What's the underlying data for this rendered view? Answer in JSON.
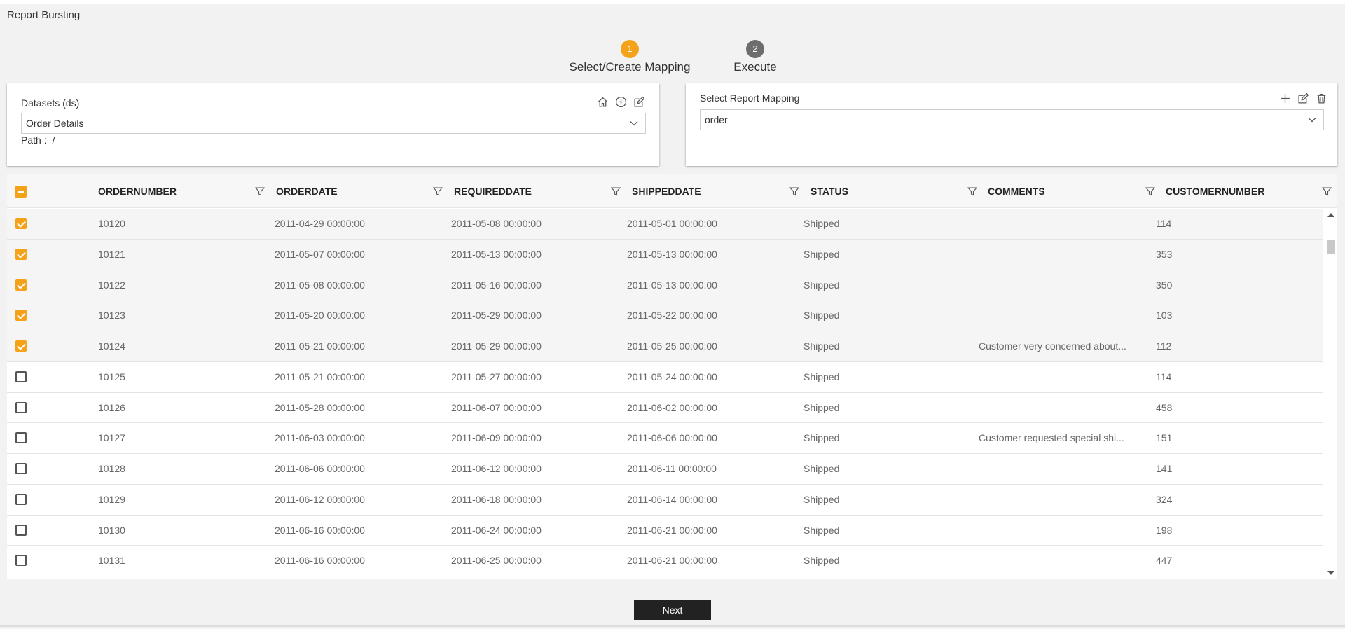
{
  "app": {
    "title": "Report Bursting"
  },
  "steps": [
    {
      "number": "1",
      "label": "Select/Create Mapping"
    },
    {
      "number": "2",
      "label": "Execute"
    }
  ],
  "dataset_panel": {
    "label": "Datasets (ds)",
    "selected": "Order Details",
    "path_label": "Path :",
    "path_value": "/"
  },
  "mapping_panel": {
    "label": "Select Report Mapping",
    "selected": "order"
  },
  "table": {
    "columns": [
      "ORDERNUMBER",
      "ORDERDATE",
      "REQUIREDDATE",
      "SHIPPEDDATE",
      "STATUS",
      "COMMENTS",
      "CUSTOMERNUMBER"
    ],
    "rows": [
      {
        "checked": true,
        "ordernumber": "10120",
        "orderdate": "2011-04-29 00:00:00",
        "requireddate": "2011-05-08 00:00:00",
        "shippeddate": "2011-05-01 00:00:00",
        "status": "Shipped",
        "comments": "",
        "customernumber": "114"
      },
      {
        "checked": true,
        "ordernumber": "10121",
        "orderdate": "2011-05-07 00:00:00",
        "requireddate": "2011-05-13 00:00:00",
        "shippeddate": "2011-05-13 00:00:00",
        "status": "Shipped",
        "comments": "",
        "customernumber": "353"
      },
      {
        "checked": true,
        "ordernumber": "10122",
        "orderdate": "2011-05-08 00:00:00",
        "requireddate": "2011-05-16 00:00:00",
        "shippeddate": "2011-05-13 00:00:00",
        "status": "Shipped",
        "comments": "",
        "customernumber": "350"
      },
      {
        "checked": true,
        "ordernumber": "10123",
        "orderdate": "2011-05-20 00:00:00",
        "requireddate": "2011-05-29 00:00:00",
        "shippeddate": "2011-05-22 00:00:00",
        "status": "Shipped",
        "comments": "",
        "customernumber": "103"
      },
      {
        "checked": true,
        "ordernumber": "10124",
        "orderdate": "2011-05-21 00:00:00",
        "requireddate": "2011-05-29 00:00:00",
        "shippeddate": "2011-05-25 00:00:00",
        "status": "Shipped",
        "comments": "Customer very concerned about...",
        "customernumber": "112"
      },
      {
        "checked": false,
        "ordernumber": "10125",
        "orderdate": "2011-05-21 00:00:00",
        "requireddate": "2011-05-27 00:00:00",
        "shippeddate": "2011-05-24 00:00:00",
        "status": "Shipped",
        "comments": "",
        "customernumber": "114"
      },
      {
        "checked": false,
        "ordernumber": "10126",
        "orderdate": "2011-05-28 00:00:00",
        "requireddate": "2011-06-07 00:00:00",
        "shippeddate": "2011-06-02 00:00:00",
        "status": "Shipped",
        "comments": "",
        "customernumber": "458"
      },
      {
        "checked": false,
        "ordernumber": "10127",
        "orderdate": "2011-06-03 00:00:00",
        "requireddate": "2011-06-09 00:00:00",
        "shippeddate": "2011-06-06 00:00:00",
        "status": "Shipped",
        "comments": "Customer requested special shi...",
        "customernumber": "151"
      },
      {
        "checked": false,
        "ordernumber": "10128",
        "orderdate": "2011-06-06 00:00:00",
        "requireddate": "2011-06-12 00:00:00",
        "shippeddate": "2011-06-11 00:00:00",
        "status": "Shipped",
        "comments": "",
        "customernumber": "141"
      },
      {
        "checked": false,
        "ordernumber": "10129",
        "orderdate": "2011-06-12 00:00:00",
        "requireddate": "2011-06-18 00:00:00",
        "shippeddate": "2011-06-14 00:00:00",
        "status": "Shipped",
        "comments": "",
        "customernumber": "324"
      },
      {
        "checked": false,
        "ordernumber": "10130",
        "orderdate": "2011-06-16 00:00:00",
        "requireddate": "2011-06-24 00:00:00",
        "shippeddate": "2011-06-21 00:00:00",
        "status": "Shipped",
        "comments": "",
        "customernumber": "198"
      },
      {
        "checked": false,
        "ordernumber": "10131",
        "orderdate": "2011-06-16 00:00:00",
        "requireddate": "2011-06-25 00:00:00",
        "shippeddate": "2011-06-21 00:00:00",
        "status": "Shipped",
        "comments": "",
        "customernumber": "447"
      }
    ]
  },
  "footer": {
    "next_label": "Next"
  },
  "colors": {
    "accent": "#f5a21b",
    "step_inactive": "#6d6d6d",
    "button": "#222222"
  }
}
